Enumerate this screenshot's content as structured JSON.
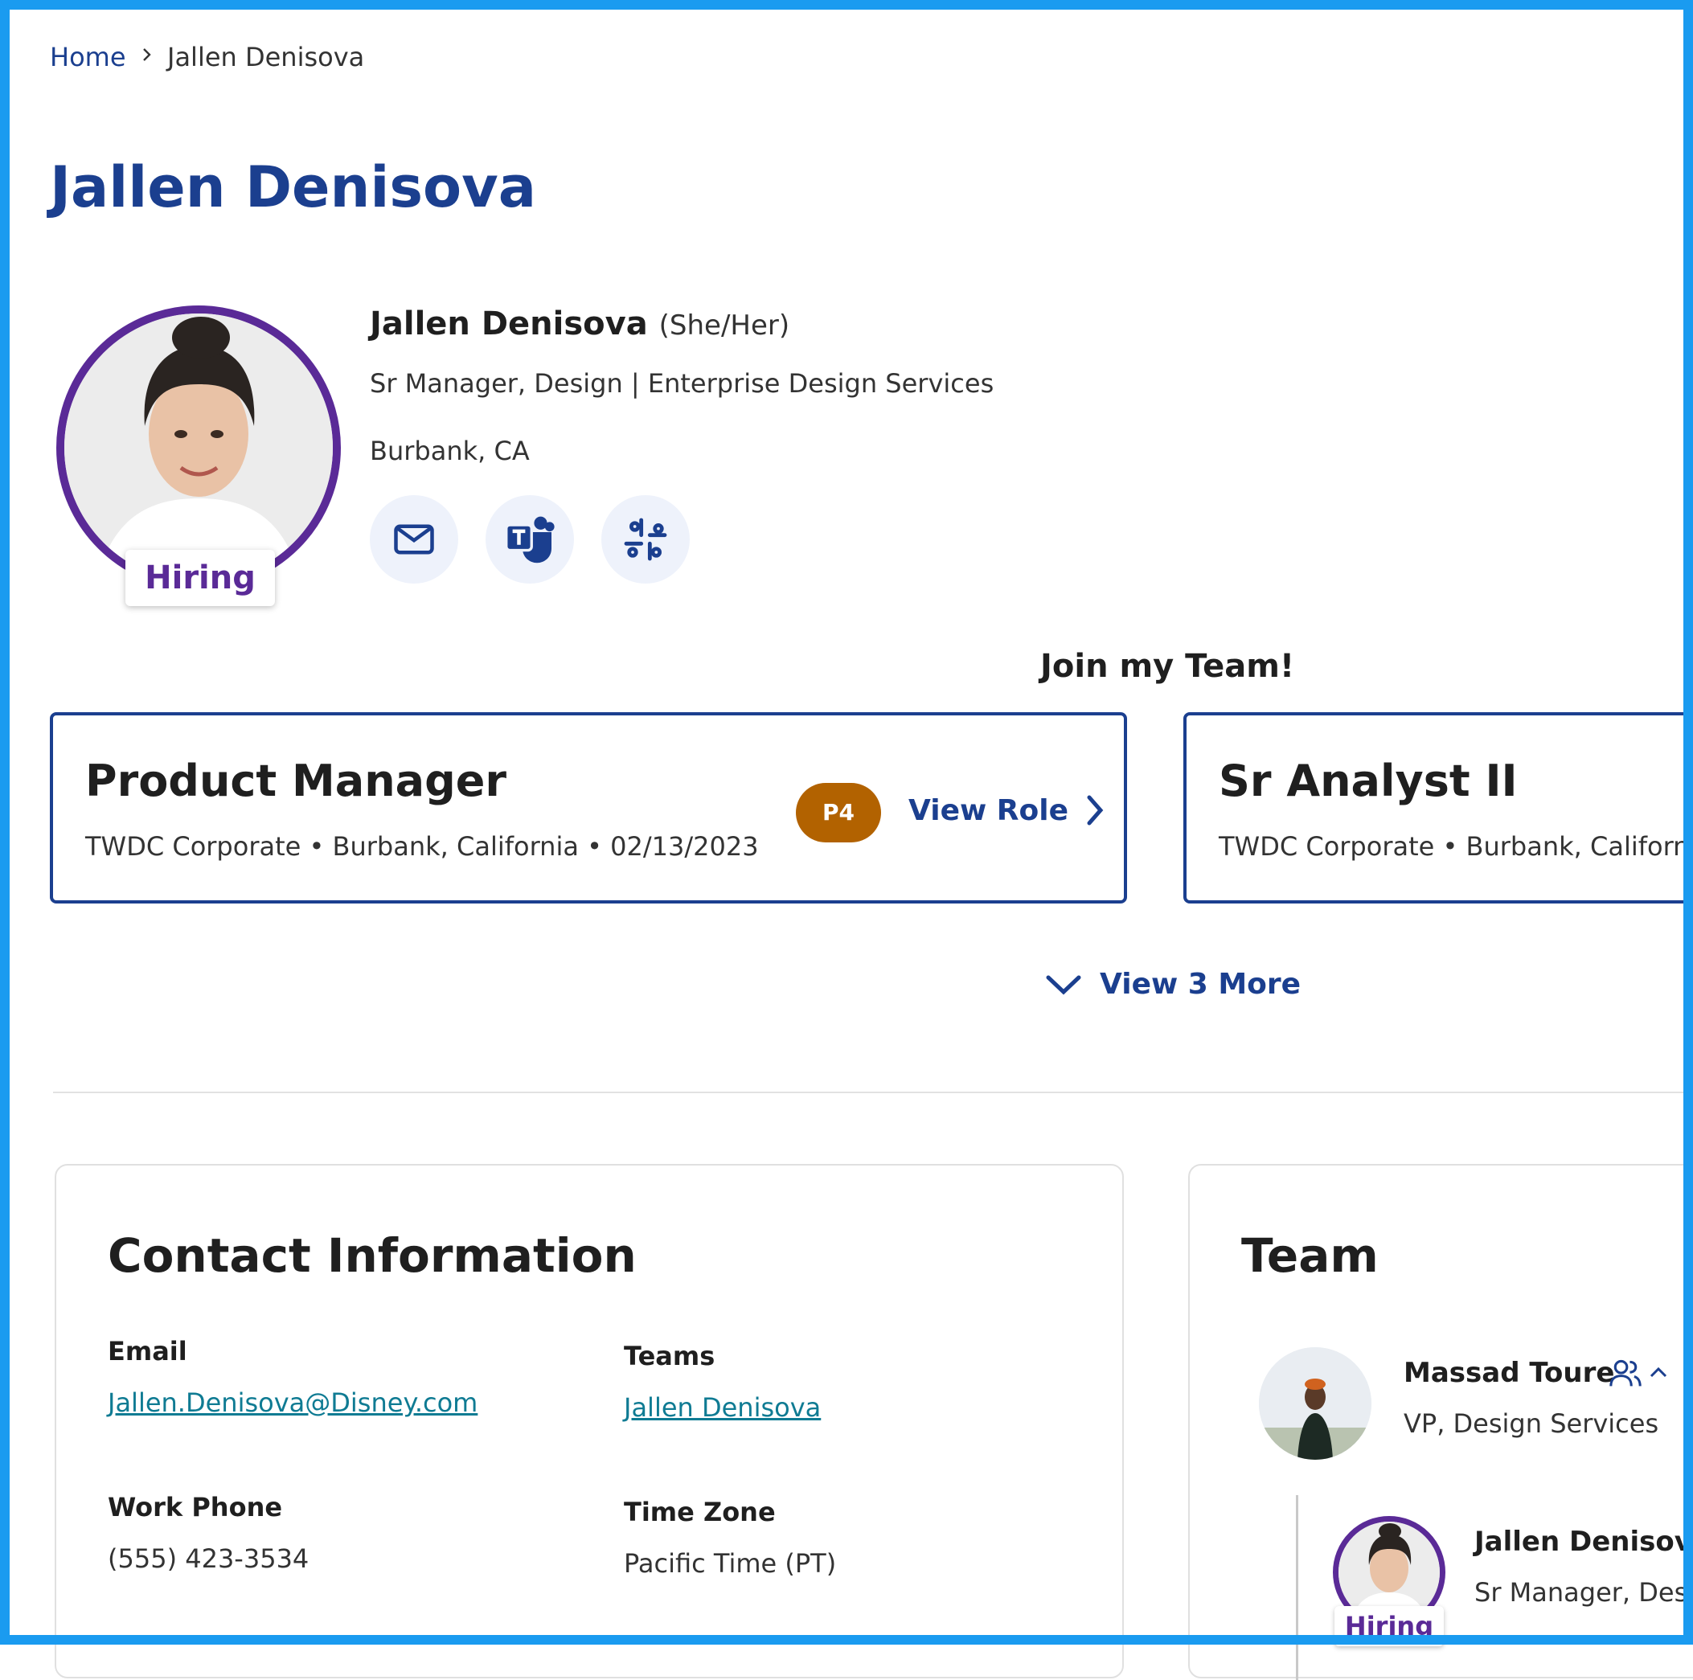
{
  "breadcrumb": {
    "home": "Home",
    "current": "Jallen Denisova"
  },
  "page_title": "Jallen Denisova",
  "profile": {
    "name": "Jallen Denisova",
    "pronouns": "(She/Her)",
    "title": "Sr Manager, Design | Enterprise Design Services",
    "location": "Burbank, CA",
    "hiring_badge": "Hiring",
    "actions": [
      {
        "icon": "mail-icon"
      },
      {
        "icon": "teams-icon"
      },
      {
        "icon": "slack-icon"
      }
    ]
  },
  "join_section": {
    "title": "Join my Team!",
    "roles": [
      {
        "name": "Product Manager",
        "meta": "TWDC Corporate • Burbank, California • 02/13/2023",
        "level": "P4",
        "cta": "View Role"
      },
      {
        "name": "Sr Analyst II",
        "meta": "TWDC Corporate • Burbank, California"
      }
    ],
    "view_more": "View 3 More"
  },
  "contact": {
    "title": "Contact Information",
    "email_label": "Email",
    "email_value": "Jallen.Denisova@Disney.com",
    "teams_label": "Teams",
    "teams_value": "Jallen Denisova",
    "phone_label": "Work Phone",
    "phone_value": "(555) 423-3534",
    "timezone_label": "Time Zone",
    "timezone_value": "Pacific Time (PT)"
  },
  "team": {
    "title": "Team",
    "manager": {
      "name": "Massad Toure",
      "role": "VP, Design Services"
    },
    "report": {
      "name": "Jallen Denisova",
      "role": "Sr Manager, Desig",
      "badge": "Hiring"
    }
  },
  "colors": {
    "brand": "#1b3f8f",
    "hiring": "#5a2a97",
    "level_pill": "#b26200",
    "link": "#0f7b93",
    "frame": "#1a9bf0"
  }
}
